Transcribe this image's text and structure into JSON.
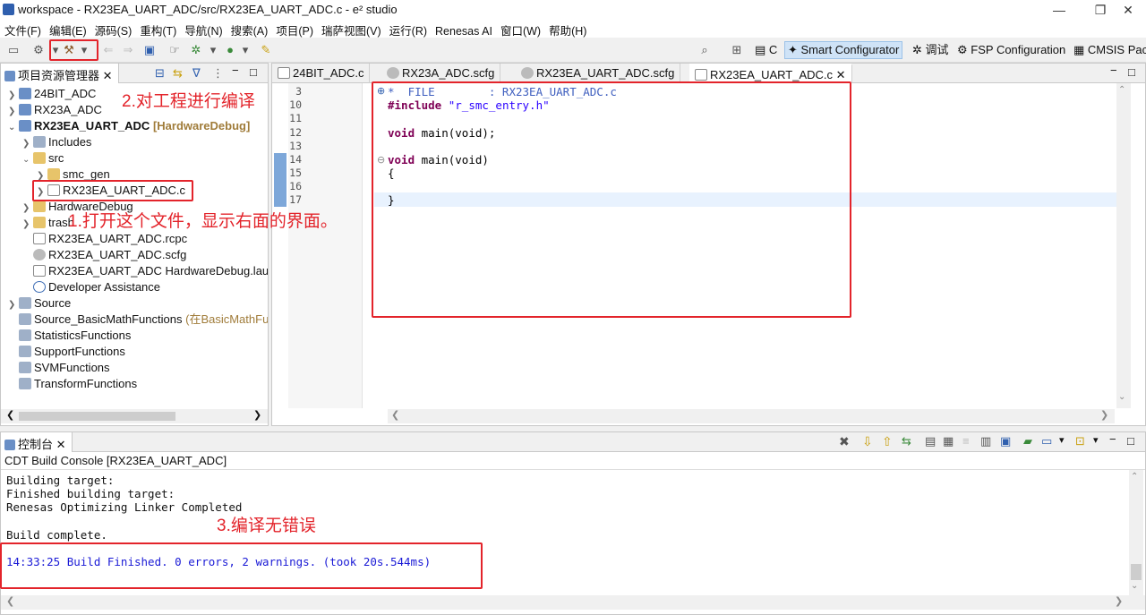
{
  "window": {
    "title": "workspace - RX23EA_UART_ADC/src/RX23EA_UART_ADC.c - e² studio",
    "controls": [
      "—",
      "❐",
      "✕"
    ]
  },
  "menubar": [
    "文件(F)",
    "编辑(E)",
    "源码(S)",
    "重构(T)",
    "导航(N)",
    "搜索(A)",
    "项目(P)",
    "瑞萨视图(V)",
    "运行(R)",
    "Renesas AI",
    "窗口(W)",
    "帮助(H)"
  ],
  "perspectives": {
    "c": "C",
    "smart": "Smart Configurator",
    "debug": "调试",
    "fsp": "FSP Configuration",
    "cmsis": "CMSIS Pac"
  },
  "project_explorer": {
    "title": "项目资源管理器",
    "items": [
      {
        "label": "24BIT_ADC"
      },
      {
        "label": "RX23A_ADC"
      },
      {
        "label": "RX23EA_UART_ADC",
        "extra": "[HardwareDebug]"
      },
      {
        "label": "Includes"
      },
      {
        "label": "src"
      },
      {
        "label": "smc_gen"
      },
      {
        "label": "RX23EA_UART_ADC.c"
      },
      {
        "label": "HardwareDebug"
      },
      {
        "label": "trash"
      },
      {
        "label": "RX23EA_UART_ADC.rcpc"
      },
      {
        "label": "RX23EA_UART_ADC.scfg"
      },
      {
        "label": "RX23EA_UART_ADC HardwareDebug.laun"
      },
      {
        "label": "Developer Assistance"
      },
      {
        "label": "Source"
      },
      {
        "label": "Source_BasicMathFunctions",
        "extra": "(在BasicMathFu"
      },
      {
        "label": "StatisticsFunctions"
      },
      {
        "label": "SupportFunctions"
      },
      {
        "label": "SVMFunctions"
      },
      {
        "label": "TransformFunctions"
      }
    ]
  },
  "editor": {
    "tabs": [
      "24BIT_ADC.c",
      "RX23A_ADC.scfg",
      "RX23EA_UART_ADC.scfg",
      "RX23EA_UART_ADC.c"
    ],
    "line_numbers": [
      "3",
      "10",
      "11",
      "12",
      "13",
      "14",
      "15",
      "16",
      "17"
    ],
    "code": {
      "l3": "*  FILE        : RX23EA_UART_ADC.c",
      "l10_kw": "#include",
      "l10_str": "\"r_smc_entry.h\"",
      "l12_kw": "void",
      "l12_rest": " main(void);",
      "l14_kw": "void",
      "l14_rest": " main(void)",
      "l15": "{",
      "l17": "}"
    }
  },
  "console": {
    "tab": "控制台",
    "subtitle": "CDT Build Console [RX23EA_UART_ADC]",
    "lines": [
      "Building target:",
      "Finished building target:",
      "Renesas Optimizing Linker Completed",
      "",
      "Build complete."
    ],
    "finish": "14:33:25 Build Finished. 0 errors, 2 warnings. (took 20s.544ms)"
  },
  "annotations": {
    "step1": "1.打开这个文件，显示右面的界面。",
    "step2": "2.对工程进行编译",
    "step3": "3.编译无错误"
  }
}
